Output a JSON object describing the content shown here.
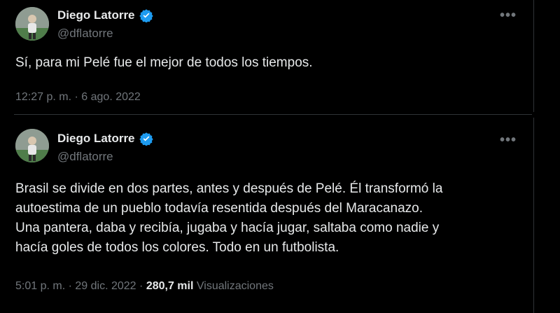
{
  "tweets": [
    {
      "author_name": "Diego Latorre",
      "handle": "@dflatorre",
      "more_icon": "more-horizontal-icon",
      "verified_icon": "verified-badge-icon",
      "text": "Sí, para mi Pelé fue el mejor de todos los tiempos.",
      "time": "12:27 p. m.",
      "separator": "·",
      "date": "6 ago. 2022"
    },
    {
      "author_name": "Diego Latorre",
      "handle": "@dflatorre",
      "more_icon": "more-horizontal-icon",
      "verified_icon": "verified-badge-icon",
      "text_lines": [
        "Brasil se divide en dos partes, antes y después de Pelé. Él transformó la",
        "autoestima de un pueblo todavía resentida después del Maracanazo.",
        "Una pantera, daba y recibía, jugaba y hacía jugar, saltaba como nadie y",
        "hacía goles de todos los colores. Todo en un futbolista."
      ],
      "time": "5:01 p. m.",
      "separator": "·",
      "date": "29 dic. 2022",
      "separator2": "·",
      "views_count": "280,7 mil",
      "views_label": "Visualizaciones"
    }
  ],
  "colors": {
    "background": "#000000",
    "text_primary": "#e7e9ea",
    "text_secondary": "#71767b",
    "verified_blue": "#1d9bf0",
    "divider": "#2f3336"
  }
}
